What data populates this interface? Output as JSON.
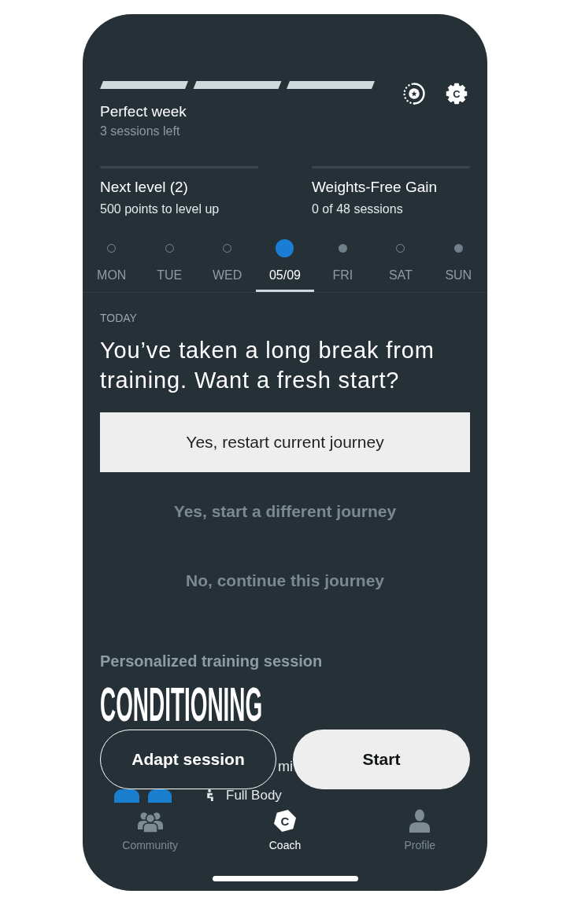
{
  "header": {
    "week_segments": [
      {
        "filled": false
      },
      {
        "filled": false
      },
      {
        "filled": false
      }
    ],
    "title": "Perfect week",
    "subtitle": "3 sessions left",
    "settings_glyph": "C"
  },
  "progress": [
    {
      "title": "Next level (2)",
      "detail": "500 points to level up",
      "level": 0
    },
    {
      "title": "Weights-Free Gain",
      "detail": "0 of 48 sessions",
      "level": 0
    }
  ],
  "days": [
    {
      "label": "MON",
      "kind": "open",
      "selected": false
    },
    {
      "label": "TUE",
      "kind": "open",
      "selected": false
    },
    {
      "label": "WED",
      "kind": "open",
      "selected": false
    },
    {
      "label": "05/09",
      "kind": "current",
      "selected": true
    },
    {
      "label": "FRI",
      "kind": "filled",
      "selected": false
    },
    {
      "label": "SAT",
      "kind": "open",
      "selected": false
    },
    {
      "label": "SUN",
      "kind": "filled",
      "selected": false
    }
  ],
  "today": {
    "label": "TODAY",
    "heading": "You’ve taken a long break from training. Want a fresh start?",
    "options": [
      {
        "label": "Yes, restart current journey",
        "kind": "primary"
      },
      {
        "label": "Yes, start a different journey",
        "kind": "text"
      },
      {
        "label": "No, continue this journey",
        "kind": "text"
      }
    ]
  },
  "session": {
    "label": "Personalized training session",
    "title": "CONDITIONING",
    "partial_text": "mi",
    "focus": "Full Body",
    "actions": [
      {
        "label": "Adapt session",
        "kind": "outline"
      },
      {
        "label": "Start",
        "kind": "filled"
      }
    ]
  },
  "tab_bar": [
    {
      "label": "Community",
      "kind": "community",
      "selected": false
    },
    {
      "label": "Coach",
      "kind": "coach",
      "glyph": "C",
      "selected": true
    },
    {
      "label": "Profile",
      "kind": "profile",
      "selected": false
    }
  ]
}
